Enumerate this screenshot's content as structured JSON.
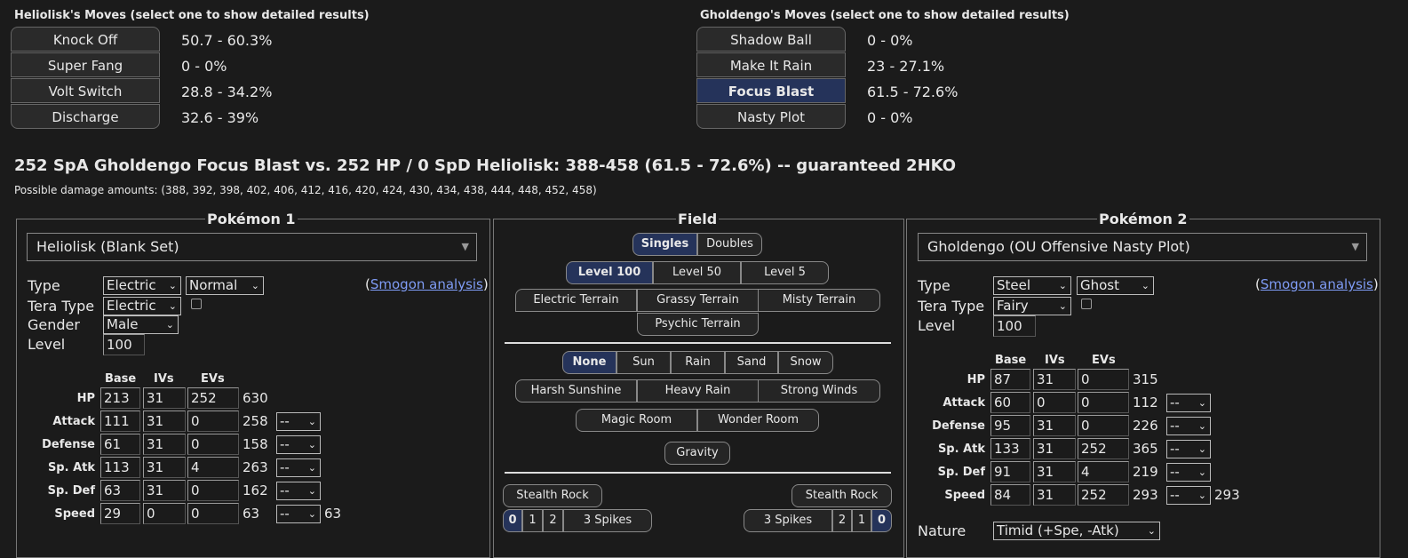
{
  "left_moves": {
    "title": "Heliolisk's Moves (select one to show detailed results)",
    "items": [
      {
        "name": "Knock Off",
        "pct": "50.7 - 60.3%"
      },
      {
        "name": "Super Fang",
        "pct": "0 - 0%"
      },
      {
        "name": "Volt Switch",
        "pct": "28.8 - 34.2%"
      },
      {
        "name": "Discharge",
        "pct": "32.6 - 39%"
      }
    ]
  },
  "right_moves": {
    "title": "Gholdengo's Moves (select one to show detailed results)",
    "items": [
      {
        "name": "Shadow Ball",
        "pct": "0 - 0%"
      },
      {
        "name": "Make It Rain",
        "pct": "23 - 27.1%"
      },
      {
        "name": "Focus Blast",
        "pct": "61.5 - 72.6%"
      },
      {
        "name": "Nasty Plot",
        "pct": "0 - 0%"
      }
    ],
    "selected": "Focus Blast"
  },
  "result": {
    "summary": "252 SpA Gholdengo Focus Blast vs. 252 HP / 0 SpD Heliolisk: 388-458 (61.5 - 72.6%) -- guaranteed 2HKO",
    "damage": "Possible damage amounts: (388, 392, 398, 402, 406, 412, 416, 420, 424, 430, 434, 438, 444, 448, 452, 458)"
  },
  "p1": {
    "legend": "Pokémon 1",
    "set": "Heliolisk (Blank Set)",
    "type_label": "Type",
    "type1": "Electric",
    "type2": "Normal",
    "smogon": "Smogon analysis",
    "tera_label": "Tera Type",
    "tera": "Electric",
    "gender_label": "Gender",
    "gender": "Male",
    "level_label": "Level",
    "level": "100",
    "hdr_base": "Base",
    "hdr_ivs": "IVs",
    "hdr_evs": "EVs",
    "stats": [
      {
        "label": "HP",
        "base": "213",
        "iv": "31",
        "ev": "252",
        "total": "630",
        "boost": ""
      },
      {
        "label": "Attack",
        "base": "111",
        "iv": "31",
        "ev": "0",
        "total": "258",
        "boost": "--"
      },
      {
        "label": "Defense",
        "base": "61",
        "iv": "31",
        "ev": "0",
        "total": "158",
        "boost": "--"
      },
      {
        "label": "Sp. Atk",
        "base": "113",
        "iv": "31",
        "ev": "4",
        "total": "263",
        "boost": "--"
      },
      {
        "label": "Sp. Def",
        "base": "63",
        "iv": "31",
        "ev": "0",
        "total": "162",
        "boost": "--"
      },
      {
        "label": "Speed",
        "base": "29",
        "iv": "0",
        "ev": "0",
        "total": "63",
        "boost": "--",
        "final": "63"
      }
    ]
  },
  "p2": {
    "legend": "Pokémon 2",
    "set": "Gholdengo (OU Offensive Nasty Plot)",
    "type_label": "Type",
    "type1": "Steel",
    "type2": "Ghost",
    "smogon": "Smogon analysis",
    "tera_label": "Tera Type",
    "tera": "Fairy",
    "level_label": "Level",
    "level": "100",
    "hdr_base": "Base",
    "hdr_ivs": "IVs",
    "hdr_evs": "EVs",
    "stats": [
      {
        "label": "HP",
        "base": "87",
        "iv": "31",
        "ev": "0",
        "total": "315",
        "boost": ""
      },
      {
        "label": "Attack",
        "base": "60",
        "iv": "0",
        "ev": "0",
        "total": "112",
        "boost": "--"
      },
      {
        "label": "Defense",
        "base": "95",
        "iv": "31",
        "ev": "0",
        "total": "226",
        "boost": "--"
      },
      {
        "label": "Sp. Atk",
        "base": "133",
        "iv": "31",
        "ev": "252",
        "total": "365",
        "boost": "--"
      },
      {
        "label": "Sp. Def",
        "base": "91",
        "iv": "31",
        "ev": "4",
        "total": "219",
        "boost": "--"
      },
      {
        "label": "Speed",
        "base": "84",
        "iv": "31",
        "ev": "252",
        "total": "293",
        "boost": "--",
        "final": "293"
      }
    ],
    "nature_label": "Nature",
    "nature": "Timid (+Spe, -Atk)"
  },
  "field": {
    "legend": "Field",
    "format": [
      "Singles",
      "Doubles"
    ],
    "format_selected": "Singles",
    "levels": [
      "Level 100",
      "Level 50",
      "Level 5"
    ],
    "level_selected": "Level 100",
    "terrains": [
      "Electric Terrain",
      "Grassy Terrain",
      "Misty Terrain",
      "Psychic Terrain"
    ],
    "weather": [
      "None",
      "Sun",
      "Rain",
      "Sand",
      "Snow"
    ],
    "weather_selected": "None",
    "weather2": [
      "Harsh Sunshine",
      "Heavy Rain",
      "Strong Winds"
    ],
    "rooms": [
      "Magic Room",
      "Wonder Room"
    ],
    "gravity": "Gravity",
    "stealth_rock": "Stealth Rock",
    "spikes_left": [
      "0",
      "1",
      "2",
      "3 Spikes"
    ],
    "spikes_right": [
      "3 Spikes",
      "2",
      "1",
      "0"
    ]
  }
}
